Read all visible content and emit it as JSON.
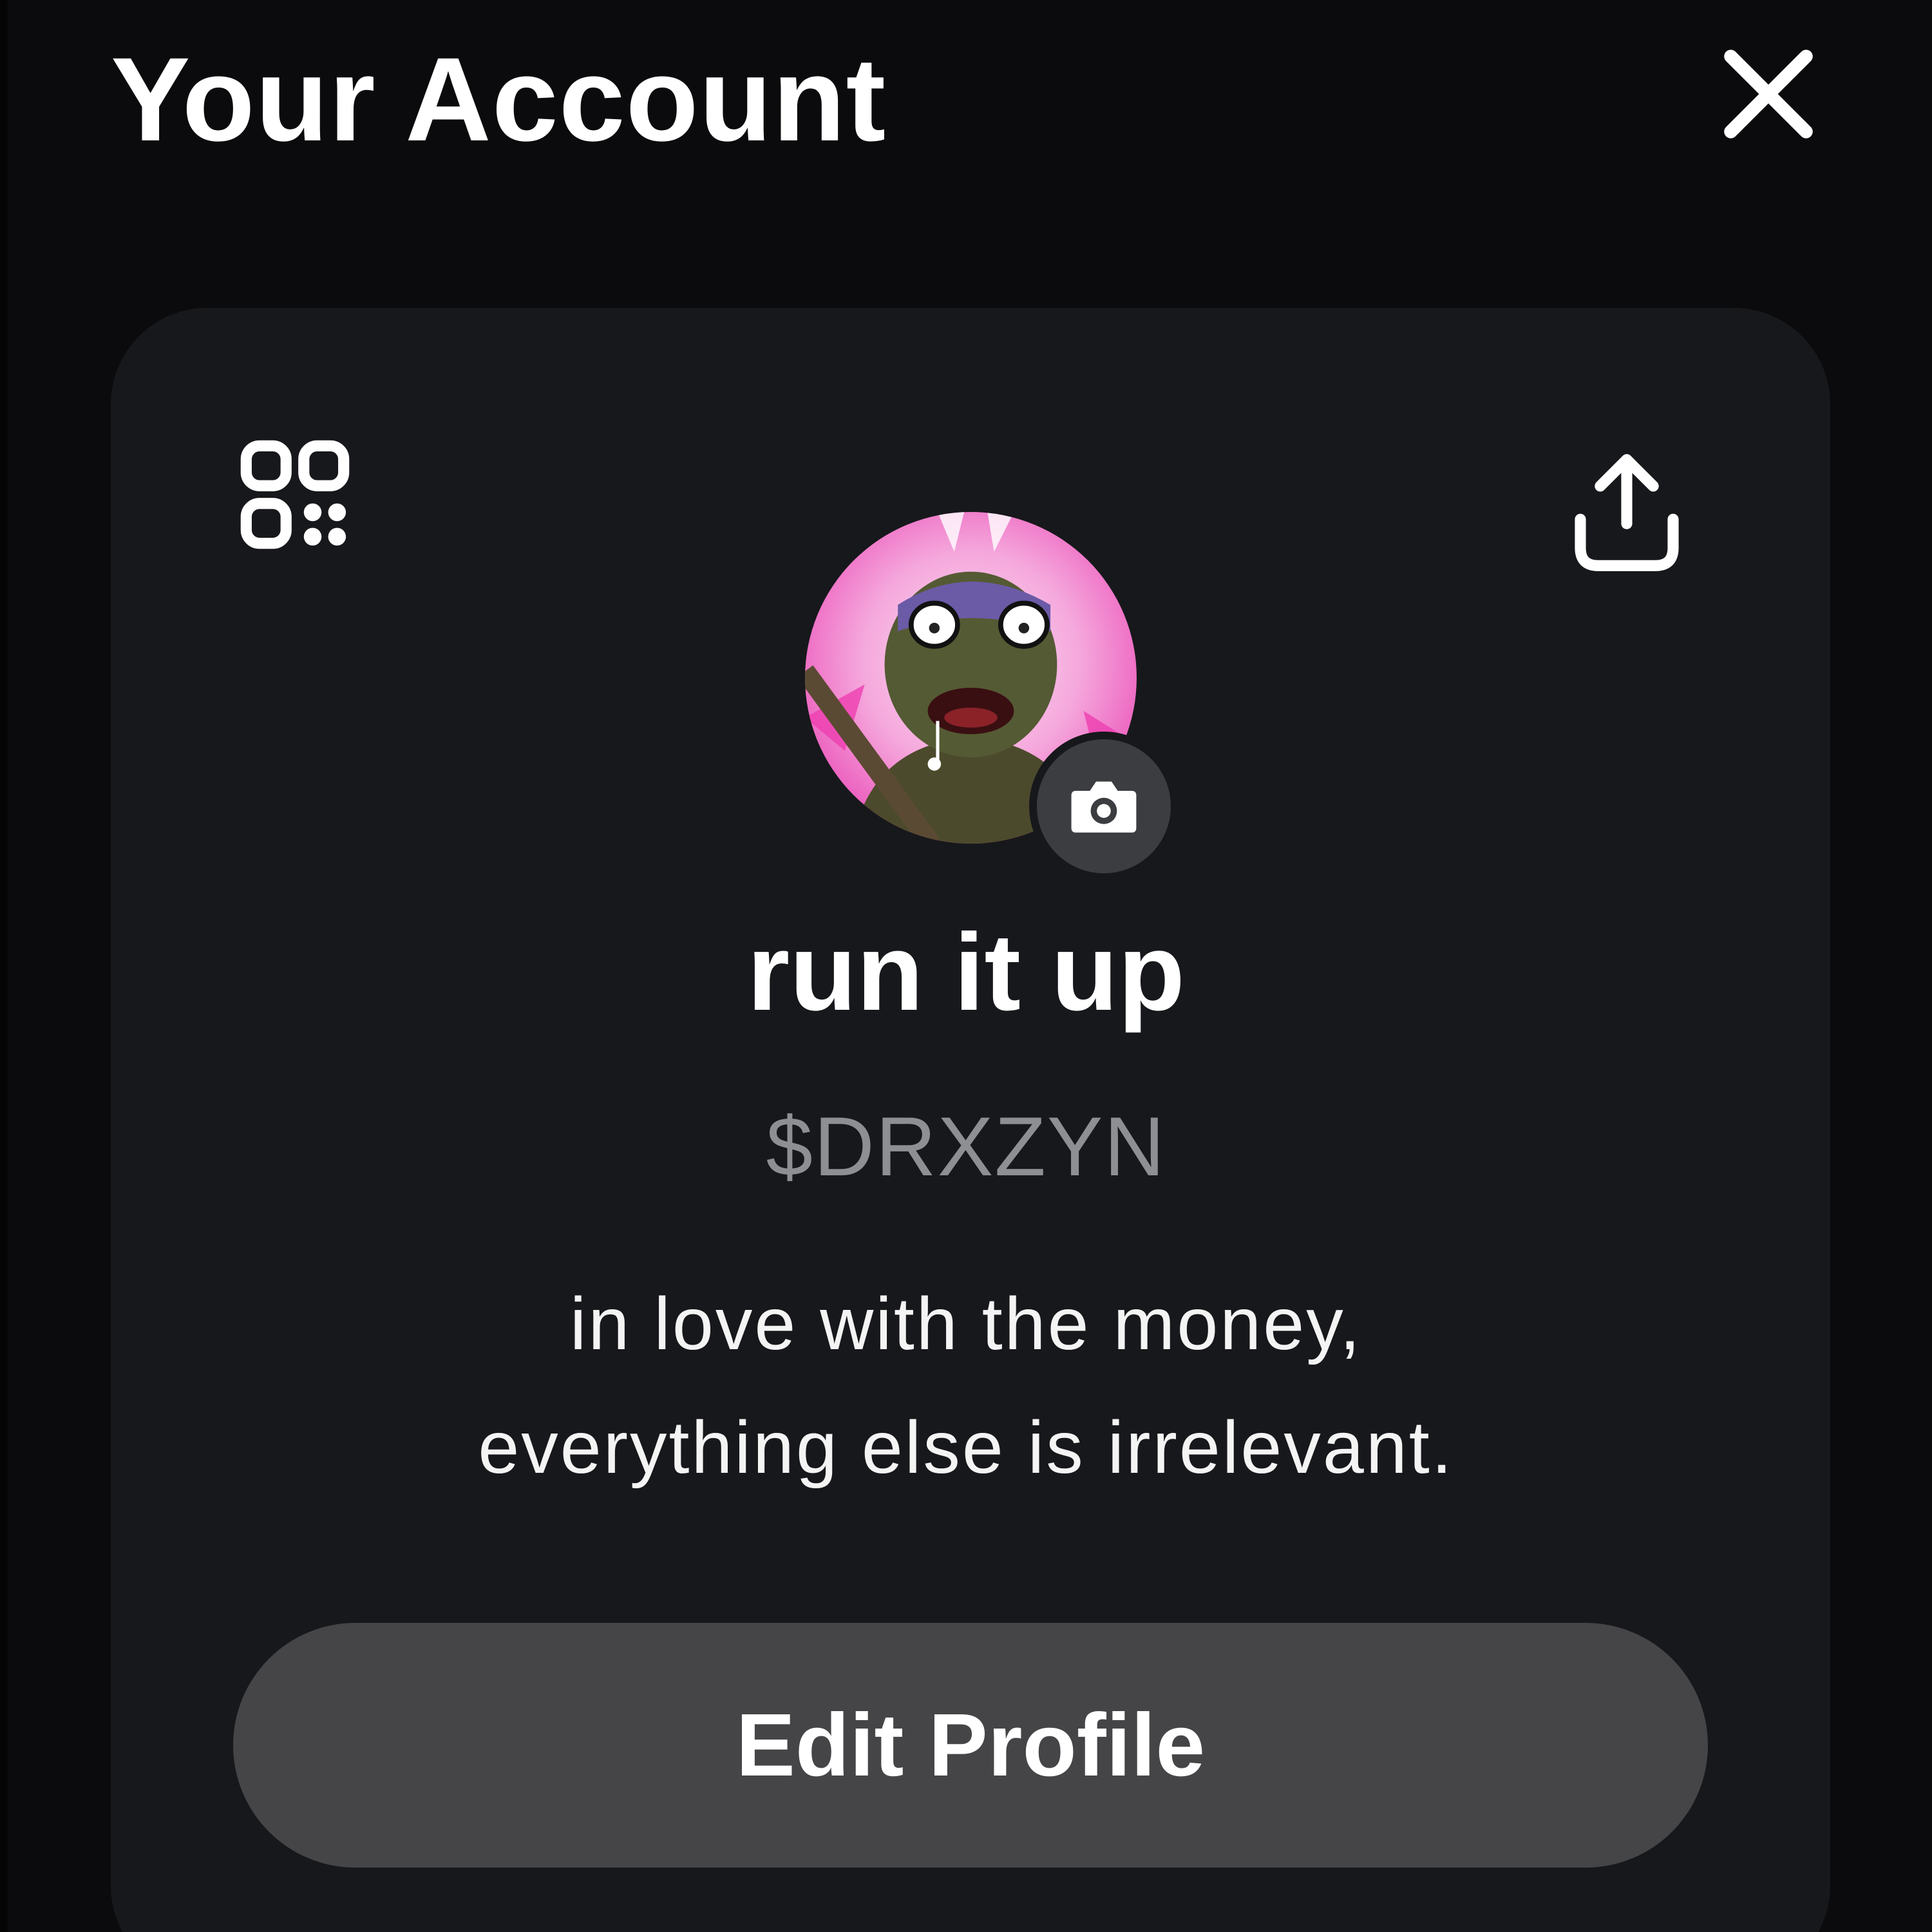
{
  "header": {
    "title": "Your Account",
    "close_icon": "close-icon"
  },
  "card": {
    "qr_icon": "qr-code-icon",
    "share_icon": "share-upload-icon",
    "avatar_icon": "profile-photo",
    "camera_icon": "camera-icon",
    "display_name": "run it up",
    "cashtag": "$DRXZYN",
    "bio_line_1": "in love with the money,",
    "bio_line_2": "everything else is irrelevant.",
    "edit_profile_label": "Edit Profile"
  },
  "colors": {
    "background": "#0b0b0d",
    "card": "#17181b",
    "button": "#454548",
    "cashtag_text": "#8e8f93",
    "avatar_pink": "#f06bc9"
  }
}
